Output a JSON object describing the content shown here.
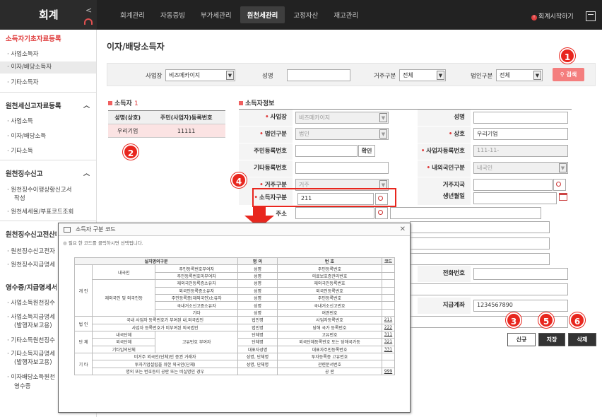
{
  "app": {
    "logo": "회계",
    "start_label": "회계시작하기"
  },
  "topmenu": [
    "회계관리",
    "자동증빙",
    "부가세관리",
    "원천세관리",
    "고정자산",
    "재고관리"
  ],
  "sidebar": {
    "sections": [
      {
        "title": "소득자기초자료등록",
        "items": [
          "사업소득자",
          "이자/배당소득자",
          "기타소득자"
        ]
      },
      {
        "title": "원천세신고자료등록",
        "items": [
          "사업소득",
          "이자/배당소득",
          "기타소득"
        ]
      },
      {
        "title": "원천징수신고",
        "items": [
          "원천징수이행상황신고서",
          "작성",
          "원천세세율/부표코드조회"
        ]
      },
      {
        "title": "원천징수신고전산매체",
        "items": [
          "원천징수신고전자",
          "원천징수지급명세"
        ]
      },
      {
        "title": "영수증/지급명세서",
        "items": [
          "사업소득원천징수",
          "사업소득지급명세",
          "(발행자보고용)",
          "기타소득원천징수",
          "기타소득지급명세",
          "(발행자보고용)",
          "이자배당소득원천",
          "영수증"
        ]
      }
    ]
  },
  "page": {
    "title": "이자/배당소득자"
  },
  "search": {
    "biz_label": "사업장",
    "biz_value": "비즈메카이지",
    "name_label": "성명",
    "name_value": "",
    "res_label": "거주구분",
    "res_value": "전체",
    "corp_label": "법인구분",
    "corp_value": "전체",
    "btn": "검색"
  },
  "income_list": {
    "title": "소득자",
    "count": "1",
    "headers": [
      "성명(상호)",
      "주민(사업자)등록번호"
    ],
    "rows": [
      [
        "우리기업",
        "11111"
      ]
    ]
  },
  "info": {
    "title": "소득자정보",
    "biz_label": "사업장",
    "biz_value": "비즈메카이지",
    "name_label": "성명",
    "name_value": "",
    "corp_label": "법인구분",
    "corp_value": "법인",
    "trade_label": "상호",
    "trade_value": "우리기업",
    "jumin_label": "주민등록번호",
    "jumin_value": "",
    "confirm": "확인",
    "bizno_label": "사업자등록번호",
    "bizno_value": "111-11-",
    "etc_label": "기타등록번호",
    "etc_value": "",
    "inout_label": "내외국인구분",
    "inout_value": "내국인",
    "res_label": "거주구분",
    "res_value": "거주",
    "country_label": "거주지국",
    "country_value": "",
    "type_label": "소득자구분",
    "type_value": "211",
    "birth_label": "생년월일",
    "birth_value": "",
    "addr_label": "주소",
    "phone_label": "전화번호",
    "phone_value": "",
    "acct_label": "지급계좌",
    "acct_value": "1234567890"
  },
  "buttons": {
    "new": "신규",
    "save": "저장",
    "delete": "삭제"
  },
  "badges": [
    "1",
    "2",
    "3",
    "4",
    "5",
    "6"
  ],
  "popup": {
    "title": "소득자 구분 코드",
    "note": "◎ 필요 한 코드를 클릭하시면 선택됩니다.",
    "headers": [
      "실지명의구분",
      "명 의",
      "번 호",
      "코드"
    ],
    "rows": [
      [
        "개 인",
        "내국인",
        "주민등록번호부여자",
        "성명",
        "주민등록번호",
        ""
      ],
      [
        "",
        "",
        "주민등록번호미부여자",
        "성명",
        "의료보호증관리번호",
        ""
      ],
      [
        "",
        "재외국인 및 외국인등",
        "재외국인등록증소유자",
        "성명",
        "재외국인등록번호",
        ""
      ],
      [
        "",
        "",
        "외국인등록증소유자",
        "성명",
        "외국인등록번호",
        ""
      ],
      [
        "",
        "",
        "주민등록증(재외국인)소유자",
        "성명",
        "주민등록번호",
        ""
      ],
      [
        "",
        "",
        "국내거소신고증소유자",
        "성명",
        "국내거소신고번호",
        ""
      ],
      [
        "",
        "",
        "기타",
        "성명",
        "여권번호",
        ""
      ],
      [
        "법 인",
        "",
        "국내 사업자 등록번호가 부여된 내,외국법인",
        "법인명",
        "사업자등록번호",
        "211"
      ],
      [
        "",
        "",
        "사업자 등록번호가 미부여된 외국법인",
        "법인명",
        "당해 국가 등록번호",
        "222"
      ],
      [
        "단 체",
        "내국단체",
        "고유번호 부여자",
        "단체명",
        "고유번호",
        "311"
      ],
      [
        "",
        "외국단체",
        "",
        "단체명",
        "외국단체등록번호 또는 당해국가등",
        "321"
      ],
      [
        "",
        "기타임의단체",
        "",
        "대표자성명",
        "대표자주민등록번호",
        "331"
      ],
      [
        "기 타",
        "",
        "비거주 외국인(단체)인 증권 거래자",
        "성명, 단체명",
        "투자등록증 고유번호",
        ""
      ],
      [
        "",
        "",
        "투자기업설립을 위한 외국인(단체)",
        "성명, 단체명",
        "관련문서번호",
        ""
      ],
      [
        "",
        "",
        "명의 또는 번호등이 공란 또는 비실명인 경우",
        "",
        "공 란",
        "999"
      ]
    ]
  }
}
